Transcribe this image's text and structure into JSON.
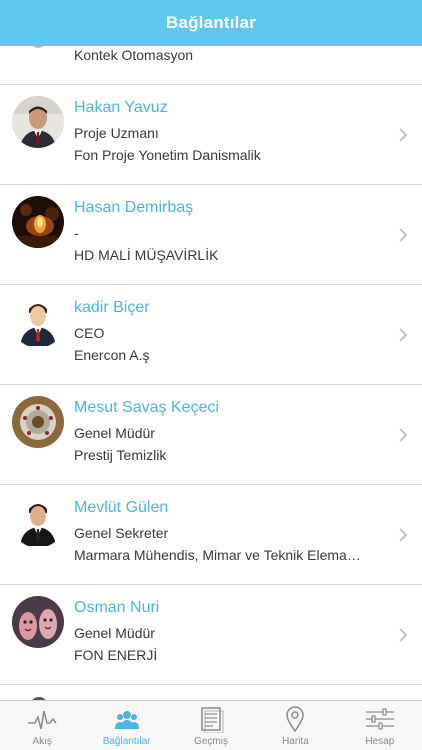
{
  "header": {
    "title": "Bağlantılar"
  },
  "partial_top": {
    "company": "Kontek Otomasyon"
  },
  "contacts": [
    {
      "name": "Hakan Yavuz",
      "role": "Proje Uzmanı",
      "company": "Fon Proje Yonetim Danismalik",
      "avatar": "photo-man-suit"
    },
    {
      "name": "Hasan Demirbaş",
      "role": "-",
      "company": "HD MALİ MÜŞAVİRLİK",
      "avatar": "photo-candle"
    },
    {
      "name": "kadir Biçer",
      "role": "CEO",
      "company": "Enercon A.ş",
      "avatar": "businessman-icon"
    },
    {
      "name": "Mesut Savaş Keçeci",
      "role": "Genel Müdür",
      "company": "Prestij Temizlik",
      "avatar": "photo-circular-object"
    },
    {
      "name": "Mevlüt Gülen",
      "role": "Genel Sekreter",
      "company": "Marmara Mühendis, Mimar ve Teknik Elema…",
      "avatar": "businessman-icon"
    },
    {
      "name": "Osman Nuri",
      "role": "Genel Müdür",
      "company": "FON ENERJİ",
      "avatar": "photo-faces"
    }
  ],
  "tabs": [
    {
      "label": "Akış",
      "icon": "heartbeat-icon",
      "active": false
    },
    {
      "label": "Bağlantılar",
      "icon": "people-icon",
      "active": true
    },
    {
      "label": "Geçmiş",
      "icon": "history-icon",
      "active": false
    },
    {
      "label": "Harita",
      "icon": "map-pin-icon",
      "active": false
    },
    {
      "label": "Hesap",
      "icon": "settings-sliders-icon",
      "active": false
    }
  ],
  "colors": {
    "accent": "#4cb6e0",
    "header_bg": "#5ec8ee",
    "text": "#3a3a3a",
    "tab_inactive": "#8a8a8a"
  }
}
